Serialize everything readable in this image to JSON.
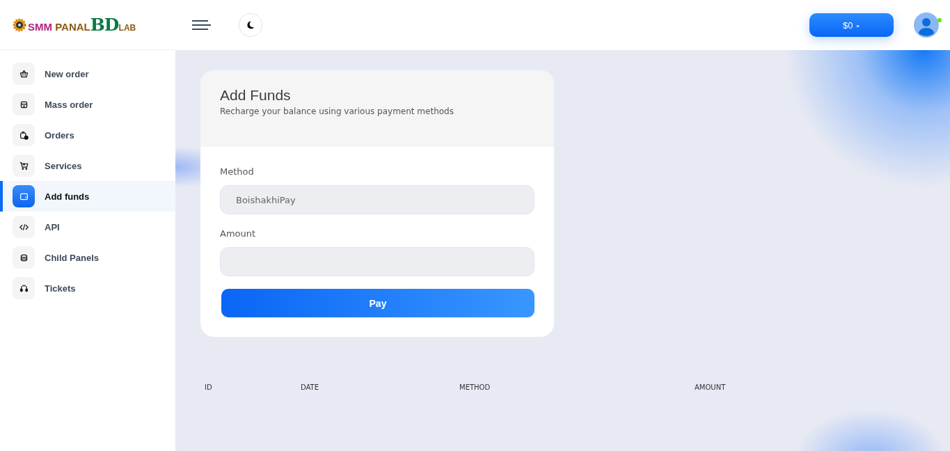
{
  "logo": {
    "parts": [
      "SMM",
      "PANAL",
      "BD",
      "LAB"
    ]
  },
  "topbar": {
    "balance": "$0",
    "user_online": true
  },
  "sidebar": {
    "items": [
      {
        "label": "New order",
        "selected": false
      },
      {
        "label": "Mass order",
        "selected": false
      },
      {
        "label": "Orders",
        "selected": false
      },
      {
        "label": "Services",
        "selected": false
      },
      {
        "label": "Add funds",
        "selected": true
      },
      {
        "label": "API",
        "selected": false
      },
      {
        "label": "Child Panels",
        "selected": false
      },
      {
        "label": "Tickets",
        "selected": false
      }
    ]
  },
  "card": {
    "title": "Add Funds",
    "subtitle": "Recharge your balance using various payment methods",
    "fields": [
      {
        "label": "Method",
        "value": "BoishakhiPay"
      },
      {
        "label": "Amount"
      }
    ],
    "button": "Pay"
  },
  "table": {
    "columns": [
      "ID",
      "DATE",
      "METHOD",
      "AMOUNT"
    ]
  }
}
